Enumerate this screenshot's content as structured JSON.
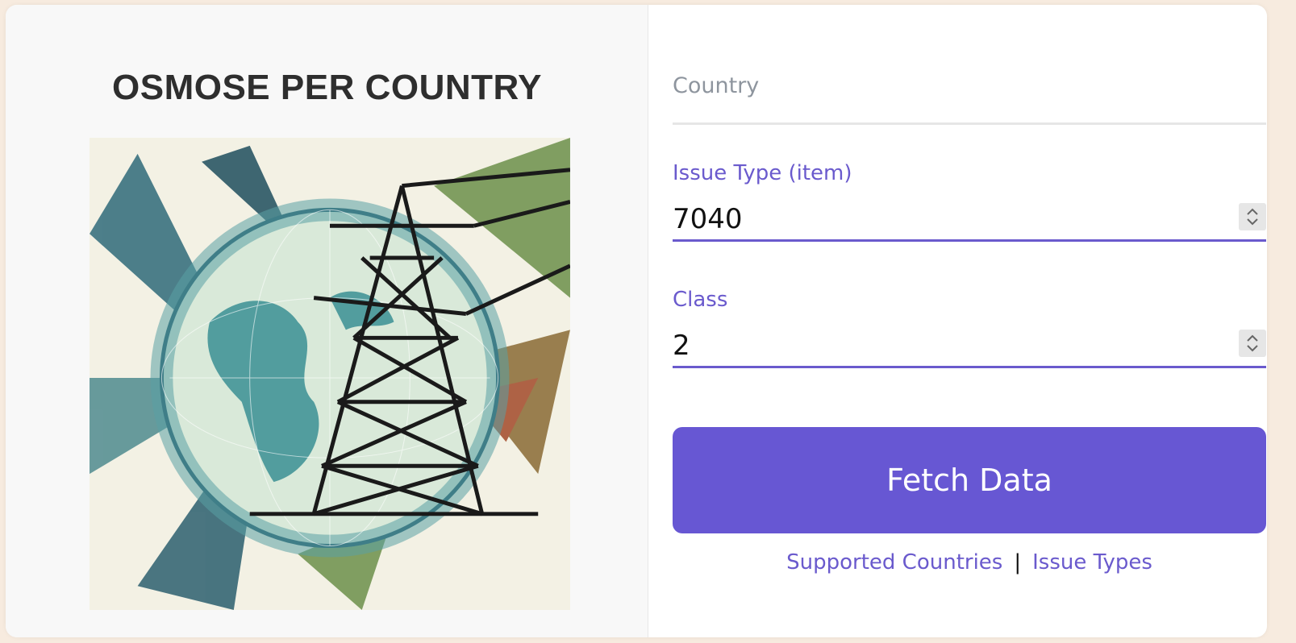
{
  "left": {
    "title": "OSMOSE PER COUNTRY",
    "image_subject": "globe-power-tower-illustration"
  },
  "form": {
    "country": {
      "placeholder": "Country",
      "value": ""
    },
    "issue_type": {
      "label": "Issue Type (item)",
      "value": "7040"
    },
    "class": {
      "label": "Class",
      "value": "2"
    },
    "submit_label": "Fetch Data"
  },
  "links": {
    "supported_countries": "Supported Countries",
    "separator": "|",
    "issue_types": "Issue Types"
  },
  "colors": {
    "accent": "#6757d3",
    "title": "#2e2e2e",
    "page_bg": "#f7ebdf"
  }
}
